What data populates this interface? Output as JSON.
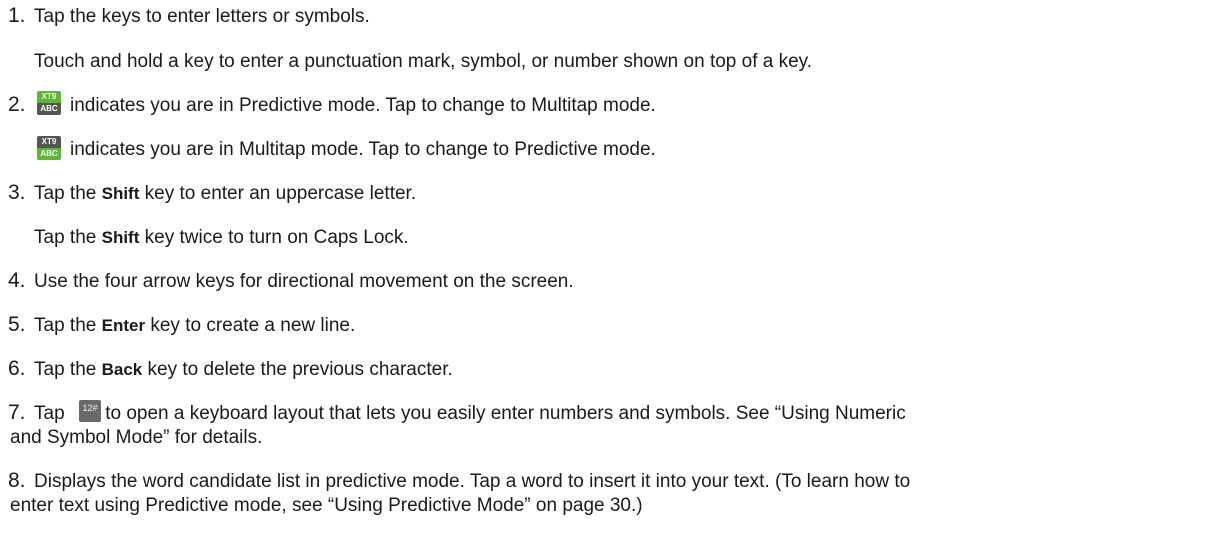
{
  "items": [
    {
      "num": "1.",
      "text": "Tap the keys to enter letters or symbols."
    },
    {
      "text": "Touch and hold a key to enter a punctuation mark, symbol, or number shown on top of a key."
    },
    {
      "num": "2.",
      "text": "indicates you are in Predictive mode. Tap to change to Multitap mode.",
      "icon_top": "XT9",
      "icon_bottom": "ABC"
    },
    {
      "text": "indicates you are in Multitap mode. Tap to change to Predictive mode.",
      "icon_top": "XT9",
      "icon_bottom": "ABC"
    },
    {
      "num": "3.",
      "pre": "Tap the ",
      "key": "Shift",
      "post": " key to enter an uppercase letter."
    },
    {
      "pre": "Tap the ",
      "key": "Shift",
      "post": " key twice to turn on Caps Lock."
    },
    {
      "num": "4.",
      "text": "Use the four arrow keys for directional movement on the screen."
    },
    {
      "num": "5.",
      "pre": "Tap the ",
      "key": "Enter",
      "post": " key to create a new line."
    },
    {
      "num": "6.",
      "pre": "Tap the ",
      "key": "Back",
      "post": " key to delete the previous character."
    },
    {
      "num": "7.",
      "pre": "Tap ",
      "icon": "12#",
      "post": " to open a keyboard layout that lets you easily enter numbers and symbols. See “Using Numeric",
      "line2": "and Symbol Mode” for details."
    },
    {
      "num": "8.",
      "text": "Displays the word candidate list in predictive mode. Tap a word to insert it into your text. (To learn how to",
      "line2": "enter text using Predictive mode, see “Using Predictive Mode” on page 30.)"
    }
  ],
  "colors": {
    "text": "#1a1a1a",
    "xt9_green": "#5cb830",
    "xt9_gray": "#555555",
    "icon_gray": "#6a6a6a"
  },
  "icons": {
    "xt9_predictive": "xt9-abc-icon",
    "xt9_multitap": "xt9-abc-icon",
    "numeric": "numeric-symbol-icon"
  }
}
